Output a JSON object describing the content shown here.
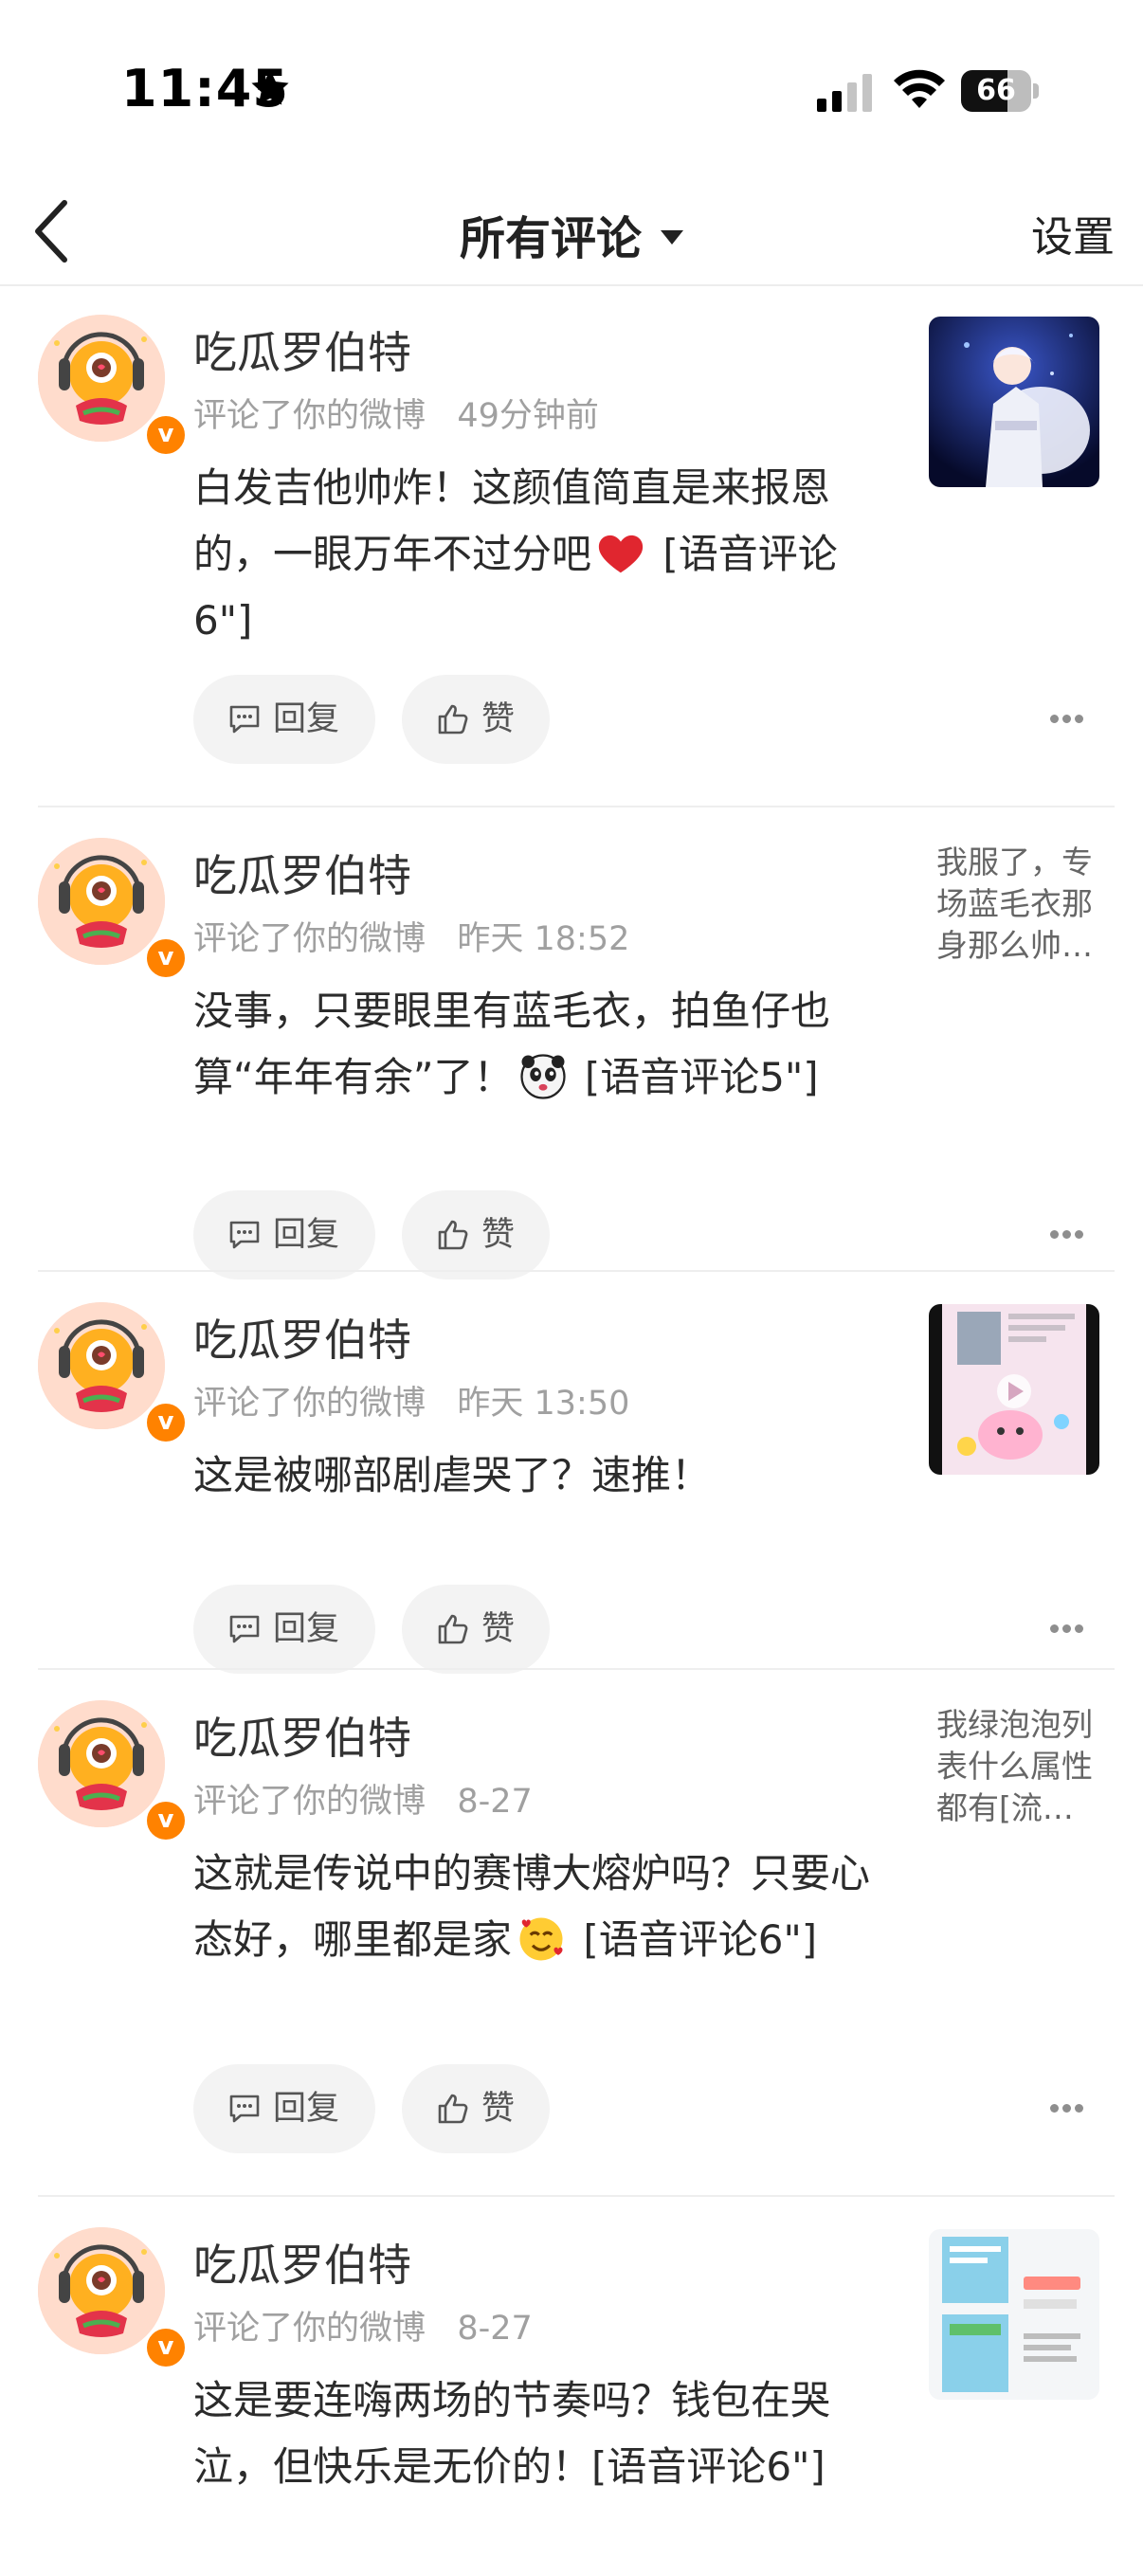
{
  "status_bar": {
    "time": "11:45",
    "battery": "66",
    "battery_level": 0.66
  },
  "nav": {
    "title": "所有评论",
    "settings": "设置"
  },
  "comments": [
    {
      "username": "吃瓜罗伯特",
      "meta": "评论了你的微博   49分钟前",
      "text_before": "白发吉他帅炸！这颜值简直是来报恩的，一眼万年不过分吧",
      "emoji": "red-heart",
      "text_after": " [语音评论6\"]",
      "reply": "回复",
      "like": "赞",
      "preview": {
        "type": "image",
        "name": "concert-photo"
      }
    },
    {
      "username": "吃瓜罗伯特",
      "meta": "评论了你的微博   昨天 18:52",
      "text_before": "没事，只要眼里有蓝毛衣，拍鱼仔也算“年年有余”了！",
      "emoji": "panda-face",
      "text_after": " [语音评论5\"]",
      "reply": "回复",
      "like": "赞",
      "preview": {
        "type": "text",
        "text": "我服了，专场蓝毛衣那身那么帅…"
      }
    },
    {
      "username": "吃瓜罗伯特",
      "meta": "评论了你的微博   昨天 13:50",
      "text_before": "这是被哪部剧虐哭了？速推！",
      "emoji": "",
      "text_after": "",
      "reply": "回复",
      "like": "赞",
      "preview": {
        "type": "image",
        "name": "video-screenshot"
      }
    },
    {
      "username": "吃瓜罗伯特",
      "meta": "评论了你的微博   8-27",
      "text_before": "这就是传说中的赛博大熔炉吗？只要心态好，哪里都是家",
      "emoji": "face-with-hearts",
      "text_after": " [语音评论6\"]",
      "reply": "回复",
      "like": "赞",
      "preview": {
        "type": "text",
        "text": "我绿泡泡列表什么属性都有[流…"
      }
    },
    {
      "username": "吃瓜罗伯特",
      "meta": "评论了你的微博   8-27",
      "text_before": "这是要连嗨两场的节奏吗？钱包在哭泣，但快乐是无价的！[语音评论6\"]",
      "emoji": "",
      "text_after": "",
      "reply": "回复",
      "like": "赞",
      "preview": {
        "type": "image",
        "name": "ticket-screenshot"
      }
    }
  ]
}
